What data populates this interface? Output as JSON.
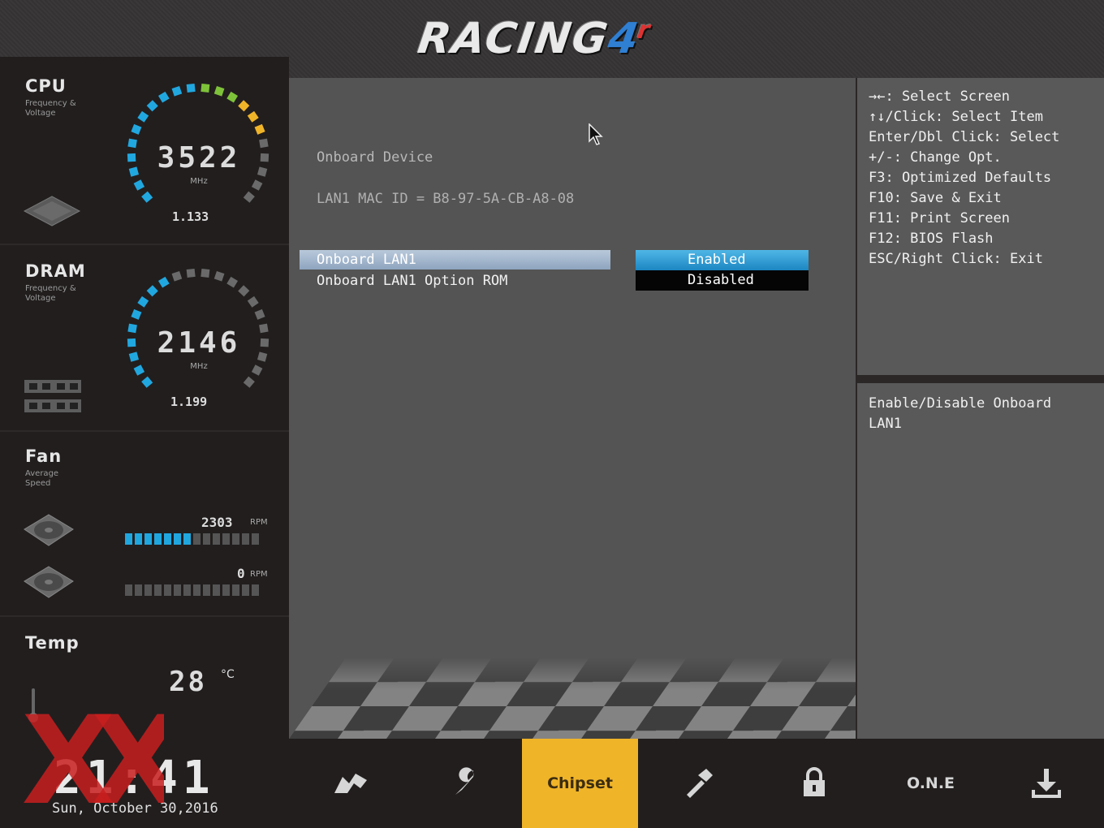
{
  "header": {
    "logo_main": "RACING",
    "logo_accent": "4",
    "logo_accent2": "r"
  },
  "monitor": {
    "cpu": {
      "title": "CPU",
      "sub": "Frequency & Voltage",
      "value": "3522",
      "unit": "MHz",
      "voltage": "1.133"
    },
    "dram": {
      "title": "DRAM",
      "sub": "Frequency & Voltage",
      "value": "2146",
      "unit": "MHz",
      "voltage": "1.199"
    },
    "fan": {
      "title": "Fan",
      "sub": "Average Speed",
      "fan1_rpm": "2303",
      "fan1_level": 0.5,
      "fan2_rpm": "0",
      "fan2_level": 0,
      "rpm_label": "RPM"
    },
    "temp": {
      "title": "Temp",
      "value": "28",
      "unit": "°C"
    }
  },
  "main": {
    "title": "Onboard Device",
    "mac": "LAN1 MAC ID = B8-97-5A-CB-A8-08",
    "options": [
      {
        "label": "Onboard LAN1"
      },
      {
        "label": "Onboard LAN1 Option ROM"
      }
    ],
    "popup": [
      {
        "label": "Enabled"
      },
      {
        "label": "Disabled"
      }
    ]
  },
  "help": {
    "keys": [
      "→←: Select Screen",
      "↑↓/Click: Select Item",
      "Enter/Dbl Click: Select",
      "+/-: Change Opt.",
      "F3: Optimized Defaults",
      "F10: Save & Exit",
      "F11: Print Screen",
      "F12: BIOS Flash",
      "ESC/Right Click: Exit"
    ],
    "description_line1": "Enable/Disable Onboard",
    "description_line2": "LAN1"
  },
  "bottom": {
    "time": "21:41",
    "date": "Sun, October  30,2016",
    "watermark": "XX",
    "tabs": {
      "chipset": "Chipset",
      "one": "O.N.E"
    }
  },
  "colors": {
    "accent_blue": "#21a7df",
    "active_tab": "#f0b429"
  }
}
